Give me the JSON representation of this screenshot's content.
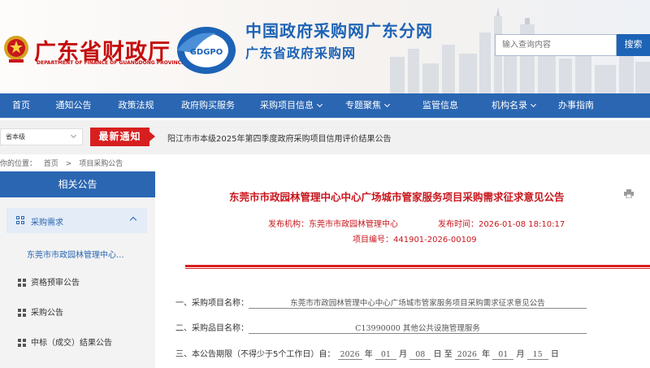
{
  "header": {
    "mof_title": "广东省财政厅",
    "mof_subtitle": "DEPARTMENT OF FINANCE OF GUANGDONG PROVINCE",
    "logo_text": "GDGPO",
    "site_title_main": "中国政府采购网广东分网",
    "site_title_sub": "广东省政府采购网",
    "search_placeholder": "输入查询内容",
    "search_button": "搜索"
  },
  "nav": {
    "items": [
      {
        "label": "首页",
        "dropdown": false
      },
      {
        "label": "通知公告",
        "dropdown": false
      },
      {
        "label": "政策法规",
        "dropdown": false
      },
      {
        "label": "政府购买服务",
        "dropdown": false
      },
      {
        "label": "采购项目信息",
        "dropdown": true
      },
      {
        "label": "专题聚焦",
        "dropdown": true
      },
      {
        "label": "监管信息",
        "dropdown": false
      },
      {
        "label": "机构名录",
        "dropdown": true
      },
      {
        "label": "办事指南",
        "dropdown": false
      }
    ]
  },
  "notice_bar": {
    "level_select": "省本级",
    "badge": "最新通知",
    "text": "阳江市市本级2025年第四季度政府采购项目信用评价结果公告"
  },
  "breadcrumb": {
    "prefix": "你的位置：",
    "home": "首页",
    "current": "项目采购公告"
  },
  "sidebar": {
    "heading": "相关公告",
    "active_item": "采购需求",
    "sub_item": "东莞市市政园林管理中心...",
    "items": [
      "资格预审公告",
      "采购公告",
      "中标（成交）结果公告"
    ]
  },
  "article": {
    "title": "东莞市市政园林管理中心中心广场城市管家服务项目采购需求征求意见公告",
    "publisher": "发布机构：东莞市市政园林管理中心",
    "publish_time": "发布时间：2026-01-08 18:10:17",
    "project_no": "项目编号：441901-2026-00109",
    "field1_label": "一、采购项目名称：",
    "field1_value": "东莞市市政园林管理中心中心广场城市管家服务项目采购需求征求意见公告",
    "field2_label": "二、采购品目名称：",
    "field2_value": "C13990000 其他公共设施管理服务",
    "field3_label": "三、本公告期限（不得少于5个工作日）自：",
    "field3": {
      "y1": "2026",
      "y_unit": "年",
      "m1": "01",
      "m_unit": "月",
      "d1": "08",
      "d_unit": "日",
      "to": "至",
      "y2": "2026",
      "m2": "01",
      "d2": "15"
    }
  },
  "colors": {
    "brand_blue": "#2a66b2",
    "title_blue": "#1d63b6",
    "alert_red": "#d71f20"
  }
}
